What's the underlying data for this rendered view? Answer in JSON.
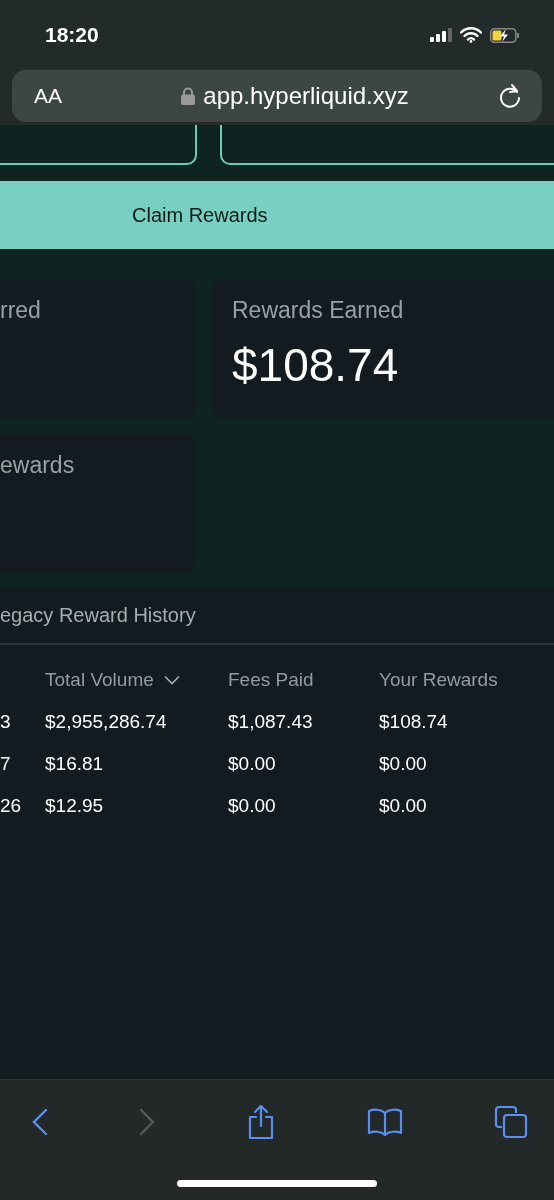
{
  "status_bar": {
    "time": "18:20",
    "charging": true
  },
  "address_bar": {
    "text_size": "AA",
    "url": "app.hyperliquid.xyz",
    "secure": true
  },
  "claim_button": {
    "label": "Claim Rewards"
  },
  "stat_cards": [
    {
      "label": "rred"
    },
    {
      "label": "Rewards Earned",
      "value": "$108.74"
    },
    {
      "label": "ewards"
    }
  ],
  "history": {
    "title": "egacy Reward History",
    "columns": [
      {
        "sorted": false
      },
      {
        "label": "Total Volume",
        "sorted": true
      },
      {
        "label": "Fees Paid",
        "sorted": false
      },
      {
        "label": "Your Rewards",
        "sorted": false
      }
    ],
    "rows": [
      [
        "3",
        "$2,955,286.74",
        "$1,087.43",
        "$108.74"
      ],
      [
        "7",
        "$16.81",
        "$0.00",
        "$0.00"
      ],
      [
        "26",
        "$12.95",
        "$0.00",
        "$0.00"
      ]
    ]
  },
  "toolbar": {
    "back_disabled": false,
    "forward_disabled": true
  }
}
